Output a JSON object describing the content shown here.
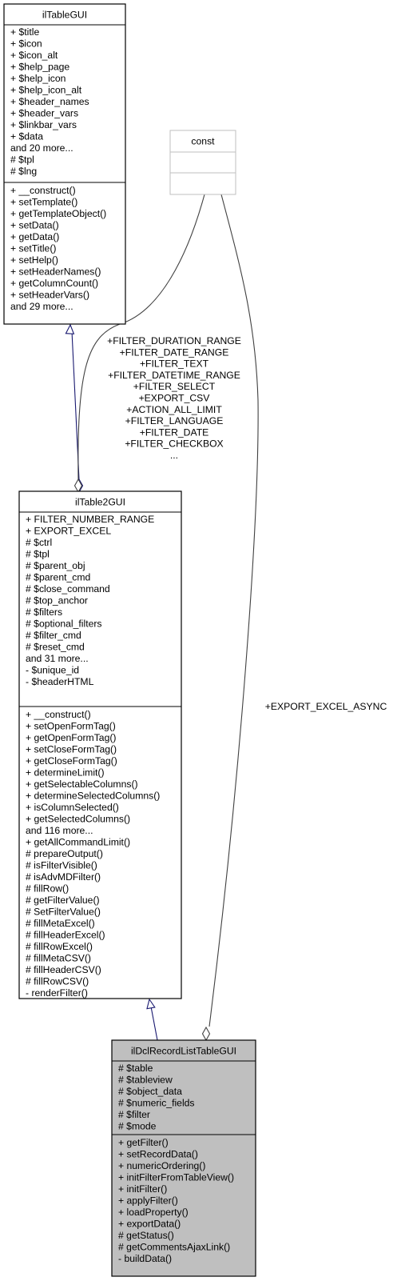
{
  "diagram": {
    "type": "uml-class-collaboration",
    "colors": {
      "box_border": "#000000",
      "box_fill": "#ffffff",
      "focus_fill": "#bfbfbf",
      "const_border": "#bfbfbf",
      "inheritance_edge": "#191970",
      "usage_edge": "#404040",
      "text": "#000000"
    },
    "classes": [
      {
        "id": "ilTableGUI",
        "name": "ilTableGUI",
        "attributes": [
          "+ $title",
          "+ $icon",
          "+ $icon_alt",
          "+ $help_page",
          "+ $help_icon",
          "+ $help_icon_alt",
          "+ $header_names",
          "+ $header_vars",
          "+ $linkbar_vars",
          "+ $data",
          "and 20 more...",
          "# $tpl",
          "# $lng"
        ],
        "methods": [
          "+ __construct()",
          "+ setTemplate()",
          "+ getTemplateObject()",
          "+ setData()",
          "+ getData()",
          "+ setTitle()",
          "+ setHelp()",
          "+ setHeaderNames()",
          "+ getColumnCount()",
          "+ setHeaderVars()",
          "and 29 more..."
        ]
      },
      {
        "id": "const",
        "name": "const",
        "attributes": [],
        "methods": []
      },
      {
        "id": "ilTable2GUI",
        "name": "ilTable2GUI",
        "attributes": [
          "+ FILTER_NUMBER_RANGE",
          "+ EXPORT_EXCEL",
          "# $ctrl",
          "# $tpl",
          "# $parent_obj",
          "# $parent_cmd",
          "# $close_command",
          "# $top_anchor",
          "# $filters",
          "# $optional_filters",
          "# $filter_cmd",
          "# $reset_cmd",
          "and 31 more...",
          "- $unique_id",
          "- $headerHTML"
        ],
        "methods": [
          "+ __construct()",
          "+ setOpenFormTag()",
          "+ getOpenFormTag()",
          "+ setCloseFormTag()",
          "+ getCloseFormTag()",
          "+ determineLimit()",
          "+ getSelectableColumns()",
          "+ determineSelectedColumns()",
          "+ isColumnSelected()",
          "+ getSelectedColumns()",
          "and 116 more...",
          "+ getAllCommandLimit()",
          "# prepareOutput()",
          "# isFilterVisible()",
          "# isAdvMDFilter()",
          "# fillRow()",
          "# getFilterValue()",
          "# SetFilterValue()",
          "# fillMetaExcel()",
          "# fillHeaderExcel()",
          "# fillRowExcel()",
          "# fillMetaCSV()",
          "# fillHeaderCSV()",
          "# fillRowCSV()",
          "- renderFilter()"
        ]
      },
      {
        "id": "ilDclRecordListTableGUI",
        "name": "ilDclRecordListTableGUI",
        "focus": true,
        "attributes": [
          "# $table",
          "# $tableview",
          "# $object_data",
          "# $numeric_fields",
          "# $filter",
          "# $mode"
        ],
        "methods": [
          "+ getFilter()",
          "+ setRecordData()",
          "+ numericOrdering()",
          "+ initFilterFromTableView()",
          "+ initFilter()",
          "+ applyFilter()",
          "+ loadProperty()",
          "+ exportData()",
          "# getStatus()",
          "# getCommentsAjaxLink()",
          "- buildData()"
        ]
      }
    ],
    "edges": [
      {
        "id": "ilTableGUI-to-ilTable2GUI",
        "from": "ilTableGUI",
        "to": "ilTable2GUI",
        "kind": "inheritance",
        "label": []
      },
      {
        "id": "const-to-ilTable2GUI",
        "from": "const",
        "to": "ilTable2GUI",
        "kind": "aggregation",
        "label": [
          "+FILTER_DURATION_RANGE",
          "+FILTER_DATE_RANGE",
          "+FILTER_TEXT",
          "+FILTER_DATETIME_RANGE",
          "+FILTER_SELECT",
          "+EXPORT_CSV",
          "+ACTION_ALL_LIMIT",
          "+FILTER_LANGUAGE",
          "+FILTER_DATE",
          "+FILTER_CHECKBOX",
          "..."
        ]
      },
      {
        "id": "ilTable2GUI-to-ilDclRecordListTableGUI",
        "from": "ilTable2GUI",
        "to": "ilDclRecordListTableGUI",
        "kind": "inheritance",
        "label": []
      },
      {
        "id": "const-to-ilDclRecordListTableGUI",
        "from": "const",
        "to": "ilDclRecordListTableGUI",
        "kind": "aggregation",
        "label": [
          "+EXPORT_EXCEL_ASYNC"
        ]
      }
    ]
  }
}
